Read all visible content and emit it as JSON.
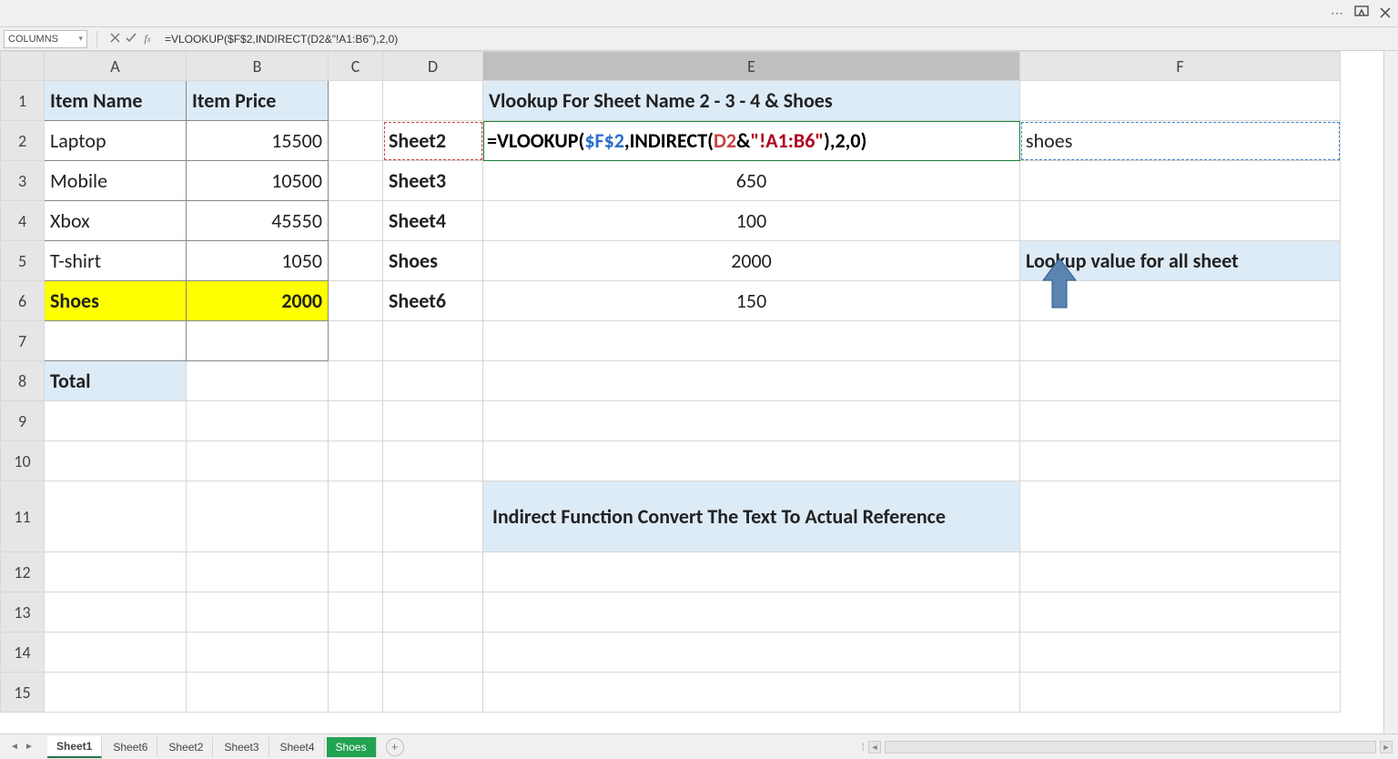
{
  "namebox": "COLUMNS",
  "formula_bar": "=VLOOKUP($F$2,INDIRECT(D2&\"!A1:B6\"),2,0)",
  "columns": [
    "A",
    "B",
    "C",
    "D",
    "E",
    "F"
  ],
  "rows": [
    "1",
    "2",
    "3",
    "4",
    "5",
    "6",
    "7",
    "8",
    "9",
    "10",
    "11",
    "12",
    "13",
    "14",
    "15"
  ],
  "data": {
    "A1": "Item Name",
    "B1": "Item Price",
    "A2": "Laptop",
    "B2": "15500",
    "A3": "Mobile",
    "B3": "10500",
    "A4": "Xbox",
    "B4": "45550",
    "A5": "T-shirt",
    "B5": "1050",
    "A6": "Shoes",
    "B6": "2000",
    "A8": "Total",
    "D2": "Sheet2",
    "D3": "Sheet3",
    "D4": "Sheet4",
    "D5": "Shoes",
    "D6": "Sheet6",
    "E1": "Vlookup For Sheet Name 2 - 3 - 4 & Shoes",
    "E3": "650",
    "E4": "100",
    "E5": "2000",
    "E6": "150",
    "E11": "Indirect Function Convert The Text To Actual Reference",
    "F2": "shoes",
    "F5": "Lookup value for all sheet"
  },
  "E2_formula_parts": {
    "p1": "=VLOOKUP(",
    "p2": "$F$2",
    "p3": ",INDIRECT(",
    "p4": "D2",
    "p5": "&",
    "p6": "\"!A1:B6\"",
    "p7": "),2,0)"
  },
  "sheet_tabs": {
    "t1": "Sheet1",
    "t2": "Sheet6",
    "t3": "Sheet2",
    "t4": "Sheet3",
    "t5": "Sheet4",
    "t6": "Shoes"
  },
  "icons": {
    "dots": "⋯"
  }
}
